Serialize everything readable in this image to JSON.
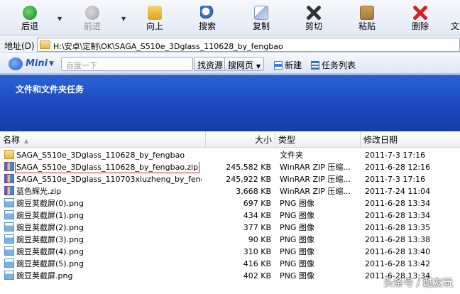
{
  "toolbar": {
    "back": "后退",
    "forward": "前进",
    "up": "向上",
    "search": "搜索",
    "copy": "复制",
    "cut": "剪切",
    "paste": "粘贴",
    "delete": "删除",
    "more": "文"
  },
  "address": {
    "label": "地址(D)",
    "path": "H:\\安卓\\定制\\OK\\SAGA_S510e_3Dglass_110628_by_fengbao"
  },
  "mini": {
    "logo": "Mini",
    "search_placeholder": "百度一下",
    "find_btn": "找资源",
    "web_btn": "搜网页",
    "new_label": "新建",
    "tasks_label": "任务列表"
  },
  "taskpane": {
    "title": "文件和文件夹任务"
  },
  "columns": {
    "name": "名称",
    "size": "大小",
    "type": "类型",
    "date": "修改日期"
  },
  "files": [
    {
      "name": "SAGA_S510e_3Dglass_110628_by_fengbao",
      "size": "",
      "type": "文件夹",
      "date": "2011-7-3 17:16",
      "icon": "folder-icon"
    },
    {
      "name": "SAGA_S510e_3Dglass_110628_by_fengbao.zip",
      "size": "245,582 KB",
      "type": "WinRAR ZIP 压缩...",
      "date": "2011-6-28 12:16",
      "icon": "zip-icon"
    },
    {
      "name": "SAGA_S510e_3Dglass_110703xiuzheng_by_fengbao...",
      "size": "245,922 KB",
      "type": "WinRAR ZIP 压缩...",
      "date": "2011-7-3 17:16",
      "icon": "zip-icon"
    },
    {
      "name": "蓝色辉光.zip",
      "size": "3,668 KB",
      "type": "WinRAR ZIP 压缩...",
      "date": "2011-7-24 11:04",
      "icon": "zip-icon"
    },
    {
      "name": "豌豆荚截屏(0).png",
      "size": "697 KB",
      "type": "PNG 图像",
      "date": "2011-6-28 13:34",
      "icon": "png-icon"
    },
    {
      "name": "豌豆荚截屏(1).png",
      "size": "434 KB",
      "type": "PNG 图像",
      "date": "2011-6-28 13:34",
      "icon": "png-icon"
    },
    {
      "name": "豌豆荚截屏(2).png",
      "size": "377 KB",
      "type": "PNG 图像",
      "date": "2011-6-28 13:35",
      "icon": "png-icon"
    },
    {
      "name": "豌豆荚截屏(3).png",
      "size": "90 KB",
      "type": "PNG 图像",
      "date": "2011-6-28 13:38",
      "icon": "png-icon"
    },
    {
      "name": "豌豆荚截屏(4).png",
      "size": "310 KB",
      "type": "PNG 图像",
      "date": "2011-6-28 13:40",
      "icon": "png-icon"
    },
    {
      "name": "豌豆荚截屏(5).png",
      "size": "416 KB",
      "type": "PNG 图像",
      "date": "2011-6-28 13:42",
      "icon": "png-icon"
    },
    {
      "name": "豌豆荚截屏.png",
      "size": "402 KB",
      "type": "PNG 图像",
      "date": "2011-6-28 13:34",
      "icon": "png-icon"
    }
  ],
  "selected_index": 1,
  "watermark": "头条号 / 酷友玩"
}
